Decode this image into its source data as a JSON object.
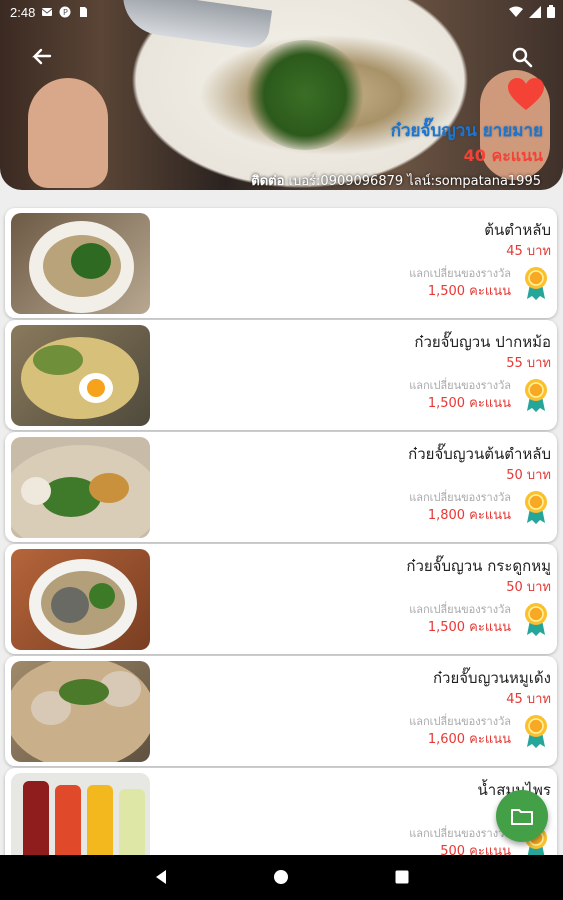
{
  "status_bar": {
    "time": "2:48"
  },
  "header": {
    "shop_name": "ก๋วยจั๊บญวน ยายมาย",
    "points": "40 คะแนน",
    "contact_label": "ติดต่อ",
    "contact_detail": " เบอร์:0909096879 ไลน์:sompatana1995"
  },
  "menu_items": [
    {
      "name": "ต้นตำหลับ",
      "price": "45 บาท",
      "exchange_label": "แลกเปลี่ยนของรางวัล",
      "exchange_points": "1,500 คะแนน"
    },
    {
      "name": "ก๋วยจั๊บญวน ปากหม้อ",
      "price": "55 บาท",
      "exchange_label": "แลกเปลี่ยนของรางวัล",
      "exchange_points": "1,500 คะแนน"
    },
    {
      "name": "ก๋วยจั๊บญวนต้นตำหลับ",
      "price": "50 บาท",
      "exchange_label": "แลกเปลี่ยนของรางวัล",
      "exchange_points": "1,800 คะแนน"
    },
    {
      "name": "ก๋วยจั๊บญวน กระดูกหมู",
      "price": "50 บาท",
      "exchange_label": "แลกเปลี่ยนของรางวัล",
      "exchange_points": "1,500 คะแนน"
    },
    {
      "name": "ก๋วยจั๊บญวนหมูเด้ง",
      "price": "45 บาท",
      "exchange_label": "แลกเปลี่ยนของรางวัล",
      "exchange_points": "1,600 คะแนน"
    },
    {
      "name": "น้ำสมุนไพร",
      "price": "",
      "exchange_label": "แลกเปลี่ยนของรางวัล",
      "exchange_points": "500 คะแนน"
    }
  ],
  "colors": {
    "accent_blue": "#1976d2",
    "accent_red": "#f44336",
    "fab_green": "#43a047"
  }
}
